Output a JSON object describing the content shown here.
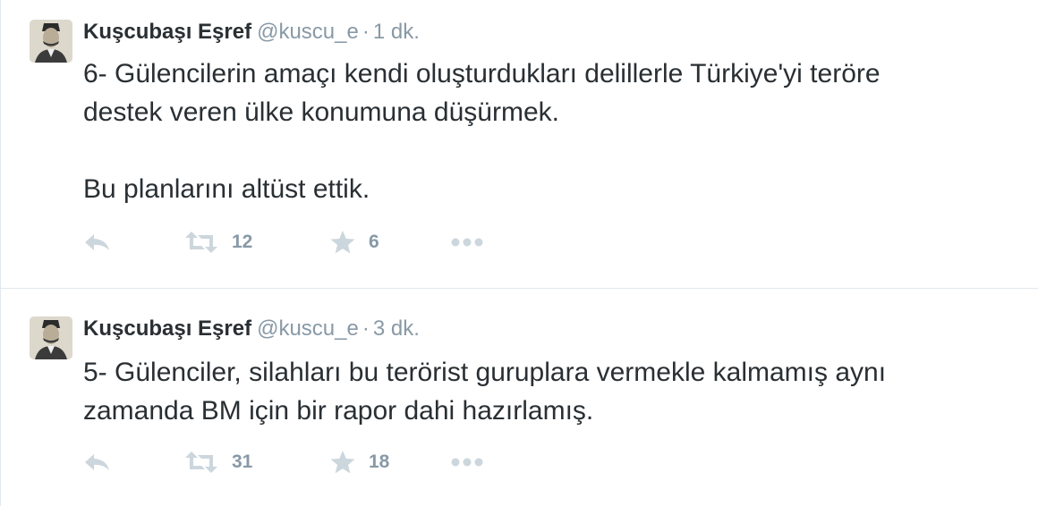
{
  "tweets": [
    {
      "fullname": "Kuşcubaşı Eşref",
      "handle": "@kuscu_e",
      "separator": "·",
      "time": "1 dk.",
      "text": "6- Gülencilerin amaçı kendi oluşturdukları delillerle Türkiye'yi teröre\ndestek veren ülke konumuna düşürmek.\n\nBu planlarını altüst ettik.",
      "retweets": "12",
      "favorites": "6"
    },
    {
      "fullname": "Kuşcubaşı Eşref",
      "handle": "@kuscu_e",
      "separator": "·",
      "time": "3 dk.",
      "text": "5- Gülenciler, silahları bu terörist guruplara vermekle kalmamış aynı\nzamanda BM için bir rapor dahi hazırlamış.",
      "retweets": "31",
      "favorites": "18"
    }
  ],
  "icons": {
    "reply": "reply-icon",
    "retweet": "retweet-icon",
    "favorite": "star-icon",
    "more": "more-dots-icon"
  },
  "colors": {
    "text": "#292f33",
    "muted": "#8899a6",
    "icon": "#ccd6dd",
    "divider": "#e1e8ed"
  }
}
